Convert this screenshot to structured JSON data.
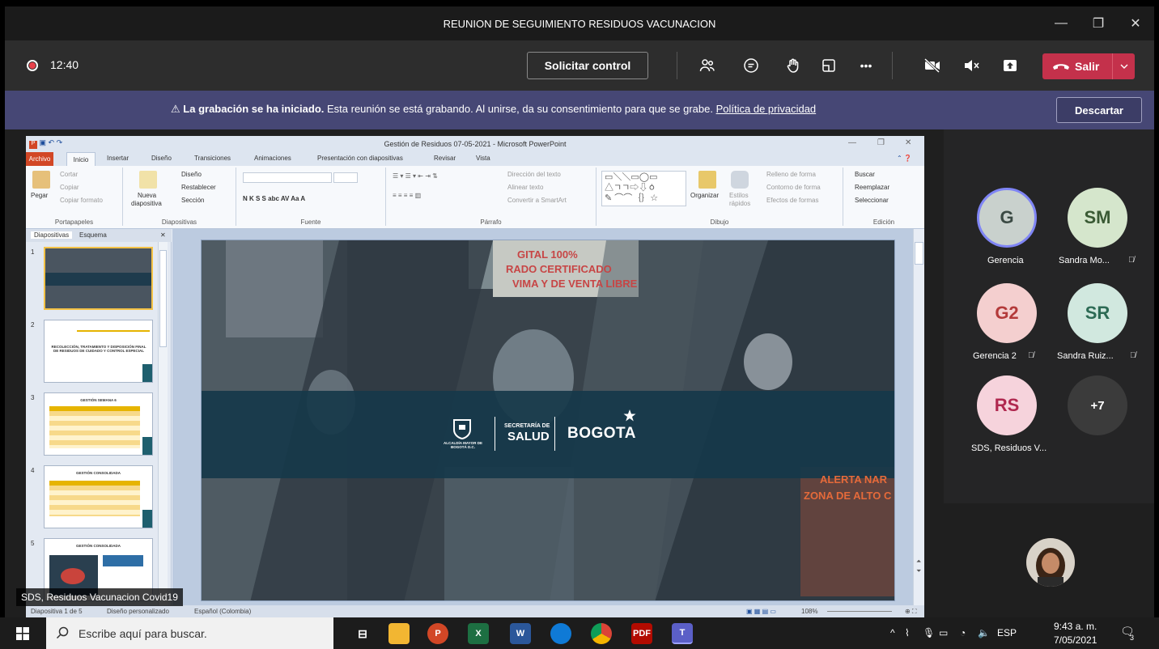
{
  "window": {
    "title": "REUNION DE SEGUIMIENTO RESIDUOS VACUNACION",
    "minimize": "—",
    "maximize": "❐",
    "close": "✕"
  },
  "toolbar": {
    "timer": "12:40",
    "request_control": "Solicitar control",
    "more": "•••",
    "leave": "Salir",
    "leave_chevron": "⌄"
  },
  "banner": {
    "bold": "La grabación se ha iniciado.",
    "text": " Esta reunión se está grabando. Al unirse, da su consentimiento para que se grabe. ",
    "link": "Política de privacidad",
    "dismiss": "Descartar",
    "warning_icon": "⚠"
  },
  "ppt": {
    "title": "Gestión de Residuos 07-05-2021 - Microsoft PowerPoint",
    "tabs": [
      "Archivo",
      "Inicio",
      "Insertar",
      "Diseño",
      "Transiciones",
      "Animaciones",
      "Presentación con diapositivas",
      "Revisar",
      "Vista"
    ],
    "clipboard": {
      "cut": "Cortar",
      "copy": "Copiar",
      "paste": "Pegar",
      "format": "Copiar formato",
      "label": "Portapapeles"
    },
    "slides_group": {
      "new": "Nueva",
      "new2": "diapositiva",
      "layout": "Diseño",
      "reset": "Restablecer",
      "section": "Sección",
      "label": "Diapositivas"
    },
    "font_group": {
      "label": "Fuente"
    },
    "paragraph_group": {
      "direction": "Dirección del texto",
      "align": "Alinear texto",
      "smartart": "Convertir a SmartArt",
      "label": "Párrafo"
    },
    "drawing_group": {
      "organize": "Organizar",
      "styles": "Estilos",
      "styles2": "rápidos",
      "fill": "Relleno de forma",
      "outline": "Contorno de forma",
      "effects": "Efectos de formas",
      "label": "Dibujo"
    },
    "editing_group": {
      "find": "Buscar",
      "replace": "Reemplazar",
      "select": "Seleccionar",
      "label": "Edición"
    },
    "panel_tabs": [
      "Diapositivas",
      "Esquema"
    ],
    "slide_nums": [
      "1",
      "2",
      "3",
      "4",
      "5"
    ],
    "thumb2_text": "RECOLECCIÓN, TRATAMIENTO Y DISPOSICIÓN FINAL DE RESIDUOS DE CUIDADO Y CONTROL ESPECIAL",
    "thumb3_title": "GESTIÓN SEMANA 6",
    "thumb4_title": "GESTIÓN CONSOLIDADA",
    "thumb5_title": "GESTIÓN CONSOLIDADA",
    "slide": {
      "sign_top": "GITAL 100%",
      "sign_mid": "RADO CERTIFICADO",
      "sign_bot": "VIMA Y DE VENTA LIBRE",
      "alert1": "ALERTA NAR",
      "alert2": "ZONA DE ALTO C",
      "alcaldia": "ALCALDÍA MAYOR DE BOGOTÁ D.C.",
      "secretaria": "SECRETARÍA DE",
      "salud": "SALUD",
      "bogota": "BOGOTA"
    },
    "status": {
      "slide": "Diapositiva 1 de 5",
      "theme": "Diseño personalizado",
      "lang": "Español (Colombia)",
      "zoom": "108%"
    }
  },
  "shared_by": "SDS, Residuos Vacunacion Covid19",
  "participants": [
    {
      "initials": "G",
      "name": "Gerencia",
      "bg": "#c9d1cd",
      "fg": "#3b4a44",
      "muted": false
    },
    {
      "initials": "SM",
      "name": "Sandra Mo...",
      "bg": "#d5e6cc",
      "fg": "#3a5a34",
      "muted": true
    },
    {
      "initials": "G2",
      "name": "Gerencia 2",
      "bg": "#f4cfcf",
      "fg": "#b33a3a",
      "muted": true
    },
    {
      "initials": "SR",
      "name": "Sandra Ruiz...",
      "bg": "#d1e8df",
      "fg": "#2d6b55",
      "muted": true
    },
    {
      "initials": "RS",
      "name": "SDS, Residuos V...",
      "bg": "#f6d3dc",
      "fg": "#b0284f",
      "muted": false
    },
    {
      "initials": "+7",
      "name": "",
      "bg": "#3b3b3b",
      "fg": "#ffffff",
      "muted": false
    }
  ],
  "taskbar": {
    "search_placeholder": "Escribe aquí para buscar.",
    "lang": "ESP",
    "time": "9:43 a. m.",
    "date": "7/05/2021",
    "notifications": "3"
  },
  "colors": {
    "teams_purple": "#464775",
    "leave_red": "#c4314b",
    "ppt_orange": "#d24726",
    "excel_green": "#1d6f42",
    "word_blue": "#2b579a"
  }
}
